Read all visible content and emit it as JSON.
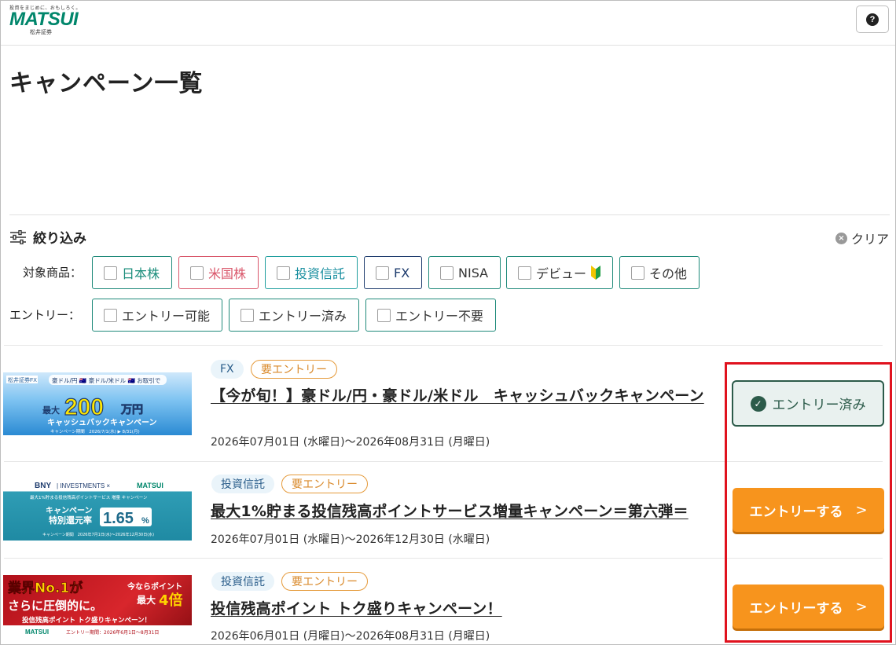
{
  "header": {
    "logo_tagline": "投資をまじめに、おもしろく。",
    "logo_text": "MATSUI",
    "logo_sub": "松井証券",
    "help_label": "?"
  },
  "page_title": "キャンペーン一覧",
  "filter": {
    "title": "絞り込み",
    "clear_label": "クリア",
    "product_label": "対象商品：",
    "entry_label": "エントリー：",
    "products": [
      "日本株",
      "米国株",
      "投資信託",
      "FX",
      "NISA",
      "デビュー",
      "その他"
    ],
    "entries": [
      "エントリー可能",
      "エントリー済み",
      "エントリー不要"
    ]
  },
  "campaigns": [
    {
      "category": "FX",
      "entry_tag": "要エントリー",
      "title": "【今が旬！】豪ドル/円・豪ドル/米ドル　キャッシュバックキャンペーン",
      "date": "2026年07月01日 (水曜日)〜2026年08月31日 (月曜日)",
      "action": "エントリー済み",
      "banner": {
        "brand": "松井証券FX",
        "top": "豪ドル/円 🇦🇺 豪ドル/米ドル 🇦🇺 お取引で",
        "prefix": "最大",
        "amount": "200",
        "unit": "万円",
        "caption": "キャッシュバックキャンペーン",
        "period": "キャンペーン期間　2026/7/1(水) ▶ 8/31(月)"
      }
    },
    {
      "category": "投資信託",
      "entry_tag": "要エントリー",
      "title": "最大1%貯まる投信残高ポイントサービス増量キャンペーン＝第六弾＝",
      "date": "2026年07月01日 (水曜日)〜2026年12月30日 (水曜日)",
      "action": "エントリーする",
      "banner": {
        "brand_left": "BNY",
        "brand_mid": "| INVESTMENTS ×",
        "brand_right": "MATSUI",
        "headline": "最大1%貯まる投信残高ポイントサービス 増量 キャンペーン",
        "line1": "キャンペーン",
        "line2": "特別還元率",
        "rate": "1.65",
        "pct": "%",
        "period": "キャンペーン期間　2026年7月1日(水)〜2026年12月30日(水)"
      }
    },
    {
      "category": "投資信託",
      "entry_tag": "要エントリー",
      "title": "投信残高ポイント トク盛りキャンペーン！",
      "date": "2026年06月01日 (月曜日)〜2026年08月31日 (月曜日)",
      "action": "エントリーする",
      "banner": {
        "line1": "業界No.1が",
        "line2": "さらに圧倒的に。",
        "right1": "今ならポイント",
        "right2": "最大",
        "right3": "4倍",
        "caption": "投信残高ポイント トク盛りキャンペーン！",
        "brand": "MATSUI",
        "period": "エントリー期間：2026年6月1日〜8月31日"
      }
    }
  ],
  "colors": {
    "brand_green": "#00866b",
    "entry_orange": "#f7941d",
    "entry_done": "#2c5b4a",
    "highlight_red": "#e0121e"
  }
}
